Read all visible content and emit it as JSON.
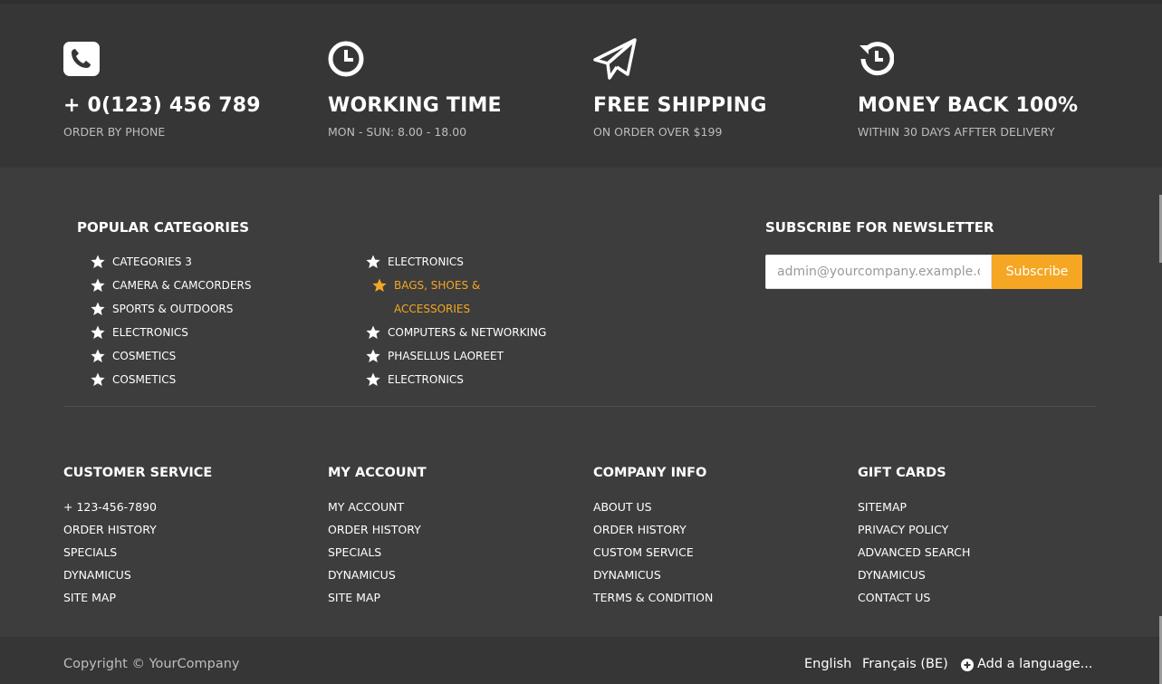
{
  "features": [
    {
      "icon": "phone-icon",
      "title": "+ 0(123) 456 789",
      "subtitle": "ORDER BY PHONE"
    },
    {
      "icon": "clock-icon",
      "title": "WORKING TIME",
      "subtitle": "MON - SUN: 8.00 - 18.00"
    },
    {
      "icon": "paper-plane-icon",
      "title": "FREE SHIPPING",
      "subtitle": "ON ORDER OVER $199"
    },
    {
      "icon": "history-icon",
      "title": "MONEY BACK 100%",
      "subtitle": "WITHIN 30 DAYS AFFTER DELIVERY"
    }
  ],
  "popular": {
    "title": "POPULAR CATEGORIES",
    "left": [
      "CATEGORIES 3",
      "CAMERA & CAMCORDERS",
      "SPORTS & OUTDOORS",
      "ELECTRONICS",
      "COSMETICS",
      "COSMETICS"
    ],
    "right": [
      "ELECTRONICS",
      "BAGS, SHOES & ACCESSORIES",
      "COMPUTERS & NETWORKING",
      "PHASELLUS LAOREET",
      "ELECTRONICS"
    ]
  },
  "newsletter": {
    "title": "SUBSCRIBE FOR NEWSLETTER",
    "placeholder": "admin@yourcompany.example.com",
    "button": "Subscribe"
  },
  "columns": [
    {
      "title": "CUSTOMER SERVICE",
      "links": [
        "+ 123-456-7890",
        "ORDER HISTORY",
        "SPECIALS",
        "DYNAMICUS",
        "SITE MAP"
      ]
    },
    {
      "title": "MY ACCOUNT",
      "links": [
        "MY ACCOUNT",
        "ORDER HISTORY",
        "SPECIALS",
        "DYNAMICUS",
        "SITE MAP"
      ]
    },
    {
      "title": "COMPANY INFO",
      "links": [
        "ABOUT US",
        "ORDER HISTORY",
        "CUSTOM SERVICE",
        "DYNAMICUS",
        "TERMS & CONDITION"
      ]
    },
    {
      "title": "GIFT CARDS",
      "links": [
        "SITEMAP",
        "PRIVACY POLICY",
        "ADVANCED SEARCH",
        "DYNAMICUS",
        "CONTACT US"
      ]
    }
  ],
  "footer": {
    "copyright": "Copyright © YourCompany",
    "languages": [
      "English",
      "Français (BE)"
    ],
    "add_language": "Add a language..."
  },
  "colors": {
    "accent": "#f5a623",
    "background": "#3d3d3d",
    "strip": "#363636"
  }
}
